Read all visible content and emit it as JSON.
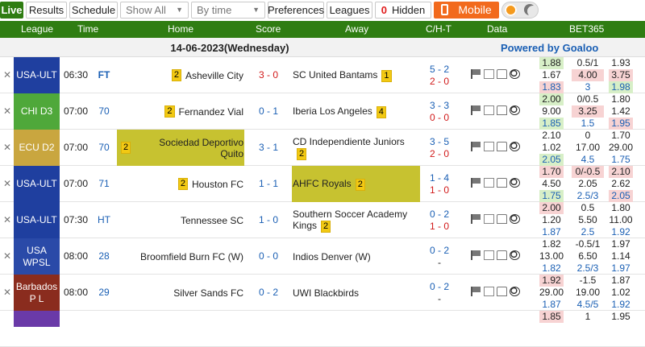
{
  "toolbar": {
    "live": "Live",
    "results": "Results",
    "schedule": "Schedule",
    "show_all": "Show All",
    "by_time": "By time",
    "preferences": "Preferences",
    "leagues": "Leagues",
    "hidden_count": "0",
    "hidden_label": "Hidden",
    "mobile": "Mobile"
  },
  "columns": {
    "league": "League",
    "time": "Time",
    "home": "Home",
    "score": "Score",
    "away": "Away",
    "cht": "C/H-T",
    "data": "Data",
    "bookmaker": "BET365"
  },
  "date": "14-06-2023(Wednesday)",
  "powered_by": "Powered by Goaloo",
  "colors": {
    "live_green": "#2f7d12",
    "mobile_orange": "#f26a1d",
    "highlight": "#c7c230",
    "card_yellow": "#f2c913"
  },
  "matches": [
    {
      "league": "USA-ULT",
      "league_color": "#1f3f9f",
      "time": "06:30",
      "status": "FT",
      "home_card": "2",
      "home": "Asheville City",
      "score": "3 - 0",
      "away": "SC United Bantams",
      "away_card": "1",
      "corners": "5 - 2",
      "halftime": "2 - 0",
      "odds": [
        [
          "1.88",
          "0.5/1",
          "1.93"
        ],
        [
          "1.67",
          "4.00",
          "3.75"
        ],
        [
          "1.83",
          "3",
          "1.98"
        ]
      ]
    },
    {
      "league": "CHI D3",
      "league_color": "#4fa83a",
      "time": "07:00",
      "status": "70",
      "home_card": "2",
      "home": "Fernandez Vial",
      "score": "0 - 1",
      "away": "Iberia Los Angeles",
      "away_card": "4",
      "corners": "3 - 3",
      "halftime": "0 - 0",
      "odds": [
        [
          "2.00",
          "0/0.5",
          "1.80"
        ],
        [
          "9.00",
          "3.25",
          "1.42"
        ],
        [
          "1.85",
          "1.5",
          "1.95"
        ]
      ]
    },
    {
      "league": "ECU D2",
      "league_color": "#c9a63f",
      "time": "07:00",
      "status": "70",
      "home_card": "2",
      "home": "Sociedad Deportivo Quito",
      "score": "3 - 1",
      "away": "CD Independiente Juniors",
      "away_card": "2",
      "corners": "3 - 5",
      "halftime": "2 - 0",
      "odds": [
        [
          "2.10",
          "0",
          "1.70"
        ],
        [
          "1.02",
          "17.00",
          "29.00"
        ],
        [
          "2.05",
          "4.5",
          "1.75"
        ]
      ]
    },
    {
      "league": "USA-ULT",
      "league_color": "#1f3f9f",
      "time": "07:00",
      "status": "71",
      "home_card": "2",
      "home": "Houston FC",
      "score": "1 - 1",
      "away": "AHFC Royals",
      "away_card": "2",
      "corners": "1 - 4",
      "halftime": "1 - 0",
      "odds": [
        [
          "1.70",
          "0/-0.5",
          "2.10"
        ],
        [
          "4.50",
          "2.05",
          "2.62"
        ],
        [
          "1.75",
          "2.5/3",
          "2.05"
        ]
      ]
    },
    {
      "league": "USA-ULT",
      "league_color": "#1f3f9f",
      "time": "07:30",
      "status": "HT",
      "home_card": "",
      "home": "Tennessee SC",
      "score": "1 - 0",
      "away": "Southern Soccer Academy Kings",
      "away_card": "2",
      "corners": "0 - 2",
      "halftime": "1 - 0",
      "odds": [
        [
          "2.00",
          "0.5",
          "1.80"
        ],
        [
          "1.20",
          "5.50",
          "11.00"
        ],
        [
          "1.87",
          "2.5",
          "1.92"
        ]
      ]
    },
    {
      "league": "USA WPSL",
      "league_color": "#2a4aa8",
      "time": "08:00",
      "status": "28",
      "home_card": "",
      "home": "Broomfield Burn FC (W)",
      "score": "0 - 0",
      "away": "Indios Denver (W)",
      "away_card": "",
      "corners": "0 - 2",
      "halftime": "-",
      "odds": [
        [
          "1.82",
          "-0.5/1",
          "1.97"
        ],
        [
          "13.00",
          "6.50",
          "1.14"
        ],
        [
          "1.82",
          "2.5/3",
          "1.97"
        ]
      ]
    },
    {
      "league": "Barbados P L",
      "league_color": "#8a2c1e",
      "time": "08:00",
      "status": "29",
      "home_card": "",
      "home": "Silver Sands FC",
      "score": "0 - 2",
      "away": "UWI Blackbirds",
      "away_card": "",
      "corners": "0 - 2",
      "halftime": "-",
      "odds": [
        [
          "1.92",
          "-1.5",
          "1.87"
        ],
        [
          "29.00",
          "19.00",
          "1.02"
        ],
        [
          "1.87",
          "4.5/5",
          "1.92"
        ]
      ]
    }
  ],
  "last_row_odds": [
    "1.85",
    "1",
    "1.95"
  ]
}
